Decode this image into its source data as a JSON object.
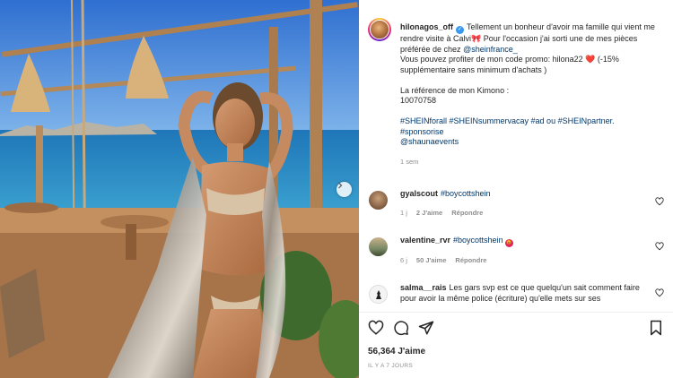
{
  "post": {
    "username": "hilonagos_off",
    "caption_1": "Tellement un bonheur d'avoir ma famille qui vient me rendre visite à Calvi",
    "caption_1_emoji": "🎀",
    "caption_1b": "Pour l'occasion j'ai sorti une de mes pièces préférée de chez",
    "mention_1": "@sheinfrance_",
    "caption_2": "Vous pouvez profiter de mon code promo: hilona22",
    "caption_2_emoji": "❤️",
    "caption_2b": "(-15% supplémentaire sans minimum d'achats )",
    "caption_3": "La référence de mon Kimono :",
    "caption_4": "10070758",
    "hashtags": "#SHEINforall #SHEINsummervacay #ad ou #SHEINpartner.",
    "hashtags_2": "#sponsorise",
    "mention_2": "@shaunaevents",
    "time": "1 sem"
  },
  "comments": [
    {
      "user": "gyalscout",
      "text": "#boycottshein",
      "time": "1 j",
      "likes": "2 J'aime",
      "reply": "Répondre"
    },
    {
      "user": "valentine_rvr",
      "text": "#boycottshein",
      "emoji": "😡",
      "time": "6 j",
      "likes": "50 J'aime",
      "reply": "Répondre"
    },
    {
      "user": "salma__rais",
      "text": "Les gars svp est ce que quelqu'un sait comment faire pour avoir la même police (écriture) qu'elle mets sur ses"
    }
  ],
  "footer": {
    "likes": "56,364 J'aime",
    "ago": "IL Y A 7 JOURS"
  },
  "icons": {
    "like": "heart-icon",
    "comment": "comment-icon",
    "share": "share-icon",
    "save": "bookmark-icon",
    "next": "chevron-right-icon"
  },
  "colors": {
    "link": "#00376b",
    "verified": "#3897f0",
    "muted": "#8e8e8e"
  }
}
